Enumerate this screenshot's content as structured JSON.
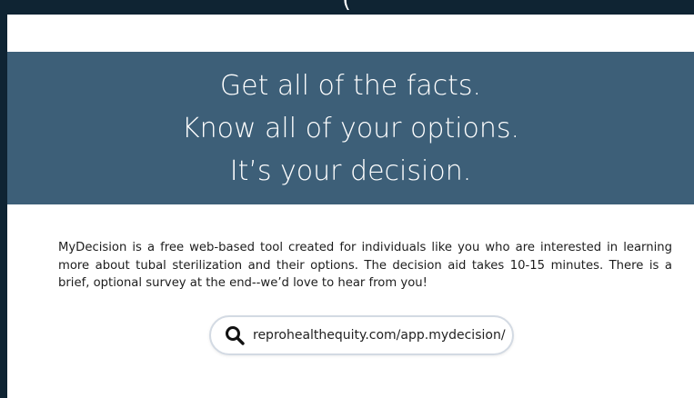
{
  "top": {
    "partial_text": "("
  },
  "banner": {
    "lines": [
      "Get all of the facts.",
      "Know all of your options.",
      "It’s your decision."
    ]
  },
  "description": "MyDecision is a free web-based tool created for individuals like you who are interested in learning more about tubal sterilization and their options. The decision aid takes 10-15 minutes. There is a brief, optional survey at the end--we’d love to hear from you!",
  "search": {
    "url": "reprohealthequity.com/app.mydecision/",
    "icon": "search-icon"
  },
  "colors": {
    "frame": "#0f2433",
    "banner": "#3d5f78",
    "card": "#ffffff",
    "pill_border": "#d3dae3"
  }
}
